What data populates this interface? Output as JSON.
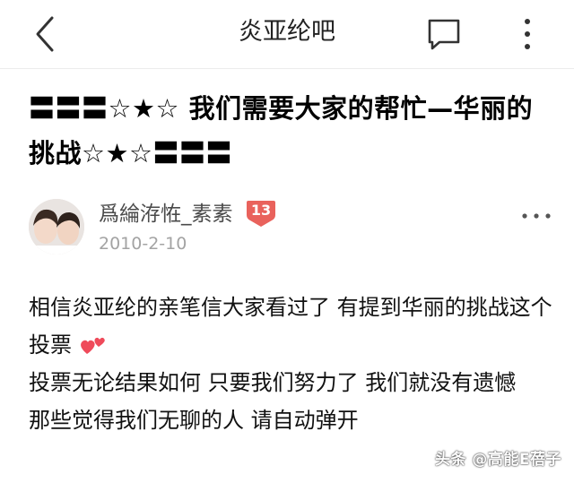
{
  "nav": {
    "title": "炎亚纶吧",
    "back_icon": "chevron-left-icon",
    "comment_icon": "comment-bubble-icon",
    "more_icon": "vertical-dots-icon"
  },
  "post": {
    "title": "〓〓〓☆★☆ 我们需要大家的帮忙—华丽的挑战☆★☆〓〓〓",
    "author": {
      "name": "爲綸洊恠_素素",
      "level": "13",
      "date": "2010-2-10"
    },
    "content": [
      "相信炎亚纶的亲笔信大家看过了 有提到华丽的挑战这个投票",
      "投票无论结果如何 只要我们努力了 我们就没有遗憾",
      "那些觉得我们无聊的人 请自动弹开"
    ]
  },
  "watermark": "头条 @高能E蓓子",
  "colors": {
    "level_badge": "#e9625c",
    "heart": "#ef4a5a",
    "date": "#a3a3a3"
  }
}
